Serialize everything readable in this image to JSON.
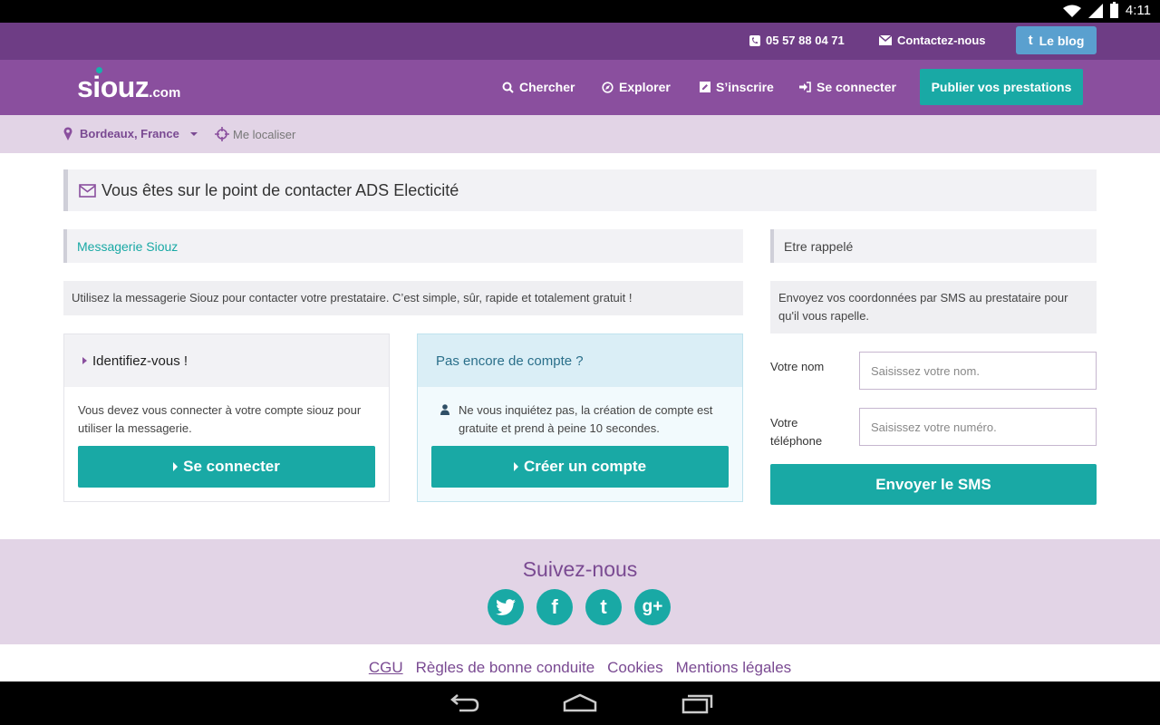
{
  "statusbar": {
    "time": "4:11"
  },
  "topbar": {
    "phone": "05 57 88 04 71",
    "contact": "Contactez-nous",
    "blog": "Le blog"
  },
  "nav": {
    "logo_main": "siouz",
    "logo_suffix": ".com",
    "search": "Chercher",
    "explore": "Explorer",
    "signup": "S’inscrire",
    "login": "Se connecter",
    "publish": "Publier vos prestations"
  },
  "location": {
    "city": "Bordeaux, France",
    "locate_me": "Me localiser"
  },
  "main": {
    "headline": "Vous êtes sur le point de contacter ADS Electicité",
    "messaging_title": "Messagerie Siouz",
    "messaging_info": "Utilisez la messagerie Siouz pour contacter votre prestataire. C’est simple, sûr, rapide et totalement gratuit !",
    "login_card": {
      "title": "Identifiez-vous !",
      "text": "Vous devez vous connecter à votre compte siouz pour utiliser la messagerie.",
      "button": "Se connecter"
    },
    "signup_card": {
      "title": "Pas encore de compte ?",
      "text": "Ne vous inquiétez pas, la création de compte est gratuite et prend à peine 10 secondes.",
      "button": "Créer un compte"
    }
  },
  "callback": {
    "title": "Etre rappelé",
    "info": "Envoyez vos coordonnées par SMS au prestataire pour qu'il vous rapelle.",
    "name_label": "Votre nom",
    "name_placeholder": "Saisissez votre nom.",
    "phone_label": "Votre téléphone",
    "phone_placeholder": "Saisissez votre numéro.",
    "send_button": "Envoyer le SMS"
  },
  "follow": {
    "title": "Suivez-nous",
    "twitter": "t",
    "facebook": "f",
    "tumblr": "t",
    "googleplus": "g+"
  },
  "footer": {
    "links": [
      "CGU",
      "Règles de bonne conduite",
      "Cookies",
      "Mentions légales"
    ]
  },
  "colors": {
    "purple_dark": "#6e3d85",
    "purple": "#8a4f9e",
    "teal": "#19a9a5",
    "lavender": "#e2d4e6",
    "blog_blue": "#5aa0cf"
  }
}
